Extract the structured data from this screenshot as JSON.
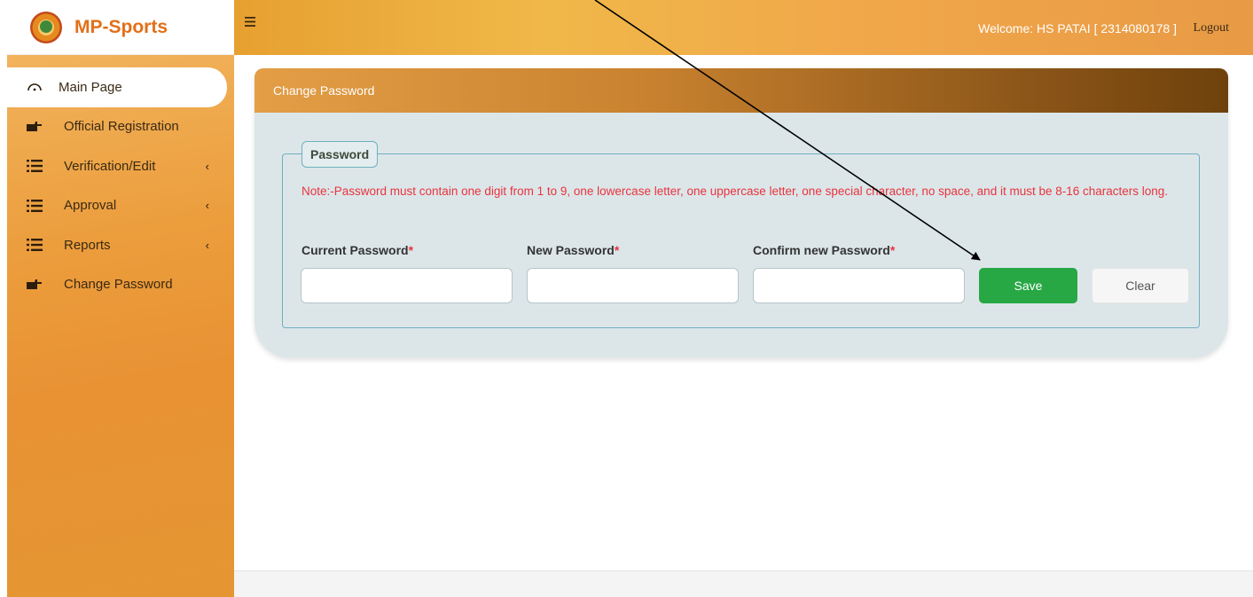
{
  "brand": {
    "name": "MP-Sports"
  },
  "sidebar": {
    "items": [
      {
        "label": "Main Page",
        "icon": "dashboard-icon",
        "active": true
      },
      {
        "label": "Official Registration",
        "icon": "pointing-hand-icon"
      },
      {
        "label": "Verification/Edit",
        "icon": "list-icon",
        "caret": "‹"
      },
      {
        "label": "Approval",
        "icon": "list-icon",
        "caret": "‹"
      },
      {
        "label": "Reports",
        "icon": "list-icon",
        "caret": "‹"
      },
      {
        "label": "Change Password",
        "icon": "pointing-hand-icon"
      }
    ]
  },
  "header": {
    "menu_icon": "hamburger-icon",
    "welcome": "Welcome: HS PATAI [ 2314080178 ]",
    "logout": "Logout"
  },
  "card": {
    "title": "Change Password",
    "legend": "Password",
    "note": "Note:-Password must contain one digit from 1 to 9, one lowercase letter, one uppercase letter, one special character, no space, and it must be 8-16 characters long.",
    "fields": {
      "current": {
        "label": "Current Password",
        "value": ""
      },
      "new": {
        "label": "New Password",
        "value": ""
      },
      "confirm": {
        "label": "Confirm new Password",
        "value": ""
      }
    },
    "required_mark": "*",
    "save_label": "Save",
    "clear_label": "Clear"
  },
  "colors": {
    "brand": "#e36f18",
    "save": "#28a745",
    "note": "#e8343d"
  }
}
